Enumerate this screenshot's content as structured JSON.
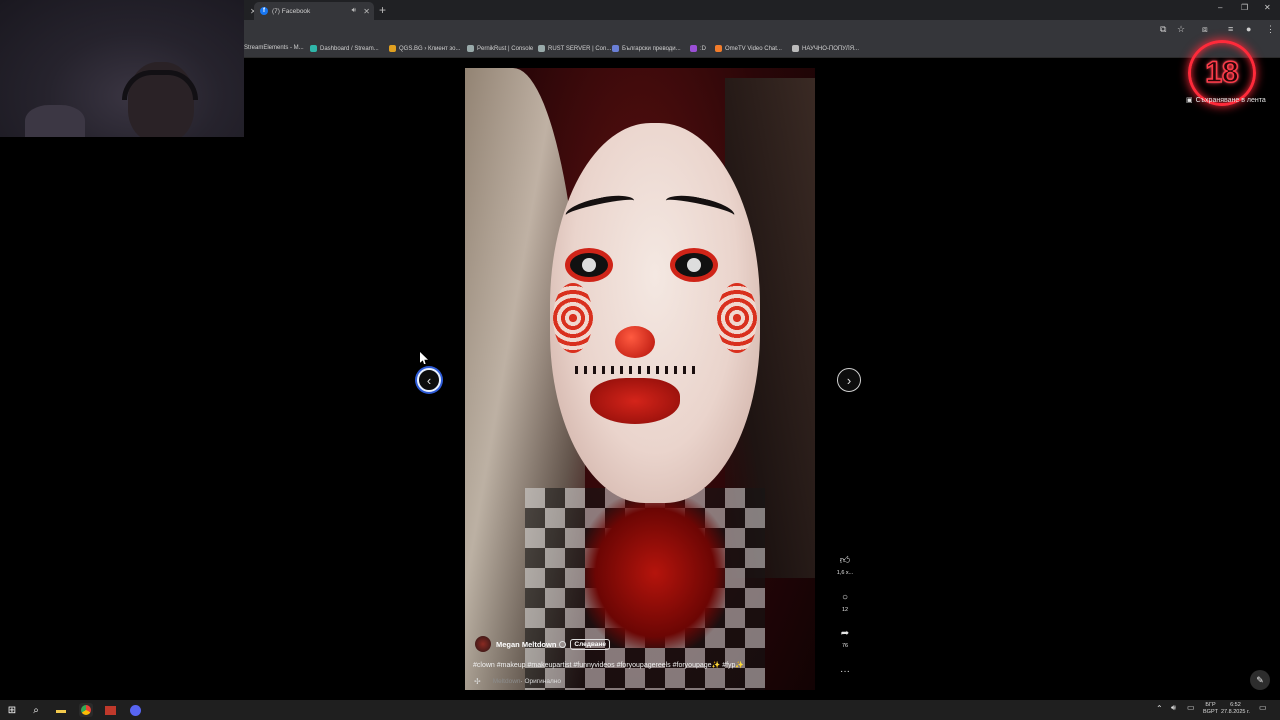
{
  "browser": {
    "tabs": [
      {
        "label": ""
      },
      {
        "label": "(7) Facebook",
        "favicon": "f"
      }
    ],
    "bookmarks": [
      {
        "label": "StreamElements - M...",
        "color": "#333"
      },
      {
        "label": "Dashboard / Stream...",
        "color": "#2fb6a9"
      },
      {
        "label": "QGS.BG › Клиент зо...",
        "color": "#e0a020"
      },
      {
        "label": "PernikRust | Console",
        "color": "#9aa"
      },
      {
        "label": "RUST SERVER | Con...",
        "color": "#9aa"
      },
      {
        "label": "Български преводи...",
        "color": "#6a7fd6"
      },
      {
        "label": ":D",
        "color": "#9b4fd6"
      },
      {
        "label": "OmeTV Video Chat...",
        "color": "#f27c2b"
      },
      {
        "label": "НАУЧНО-ПОПУЛЯ...",
        "color": "#bbb"
      }
    ]
  },
  "reel": {
    "author": "Megan Meltdown",
    "follow_label": "Следване",
    "hashtags": "#clown #makeup #makeupartist #funnyvideos #foryoupagereels #foryoupage✨ #fyp✨",
    "audio_owner": "Meltdown",
    "audio_label": " · Оригинално",
    "likes": "1,6 х...",
    "comments": "12",
    "shares": "76",
    "more": "···"
  },
  "overlay": {
    "age_badge": "18",
    "save_reel_label": "Съхраняване в лента"
  },
  "taskbar": {
    "lang_top": "БГР",
    "lang_bottom": "BGPT",
    "time": "6:52",
    "date": "27.8.2025 г."
  }
}
